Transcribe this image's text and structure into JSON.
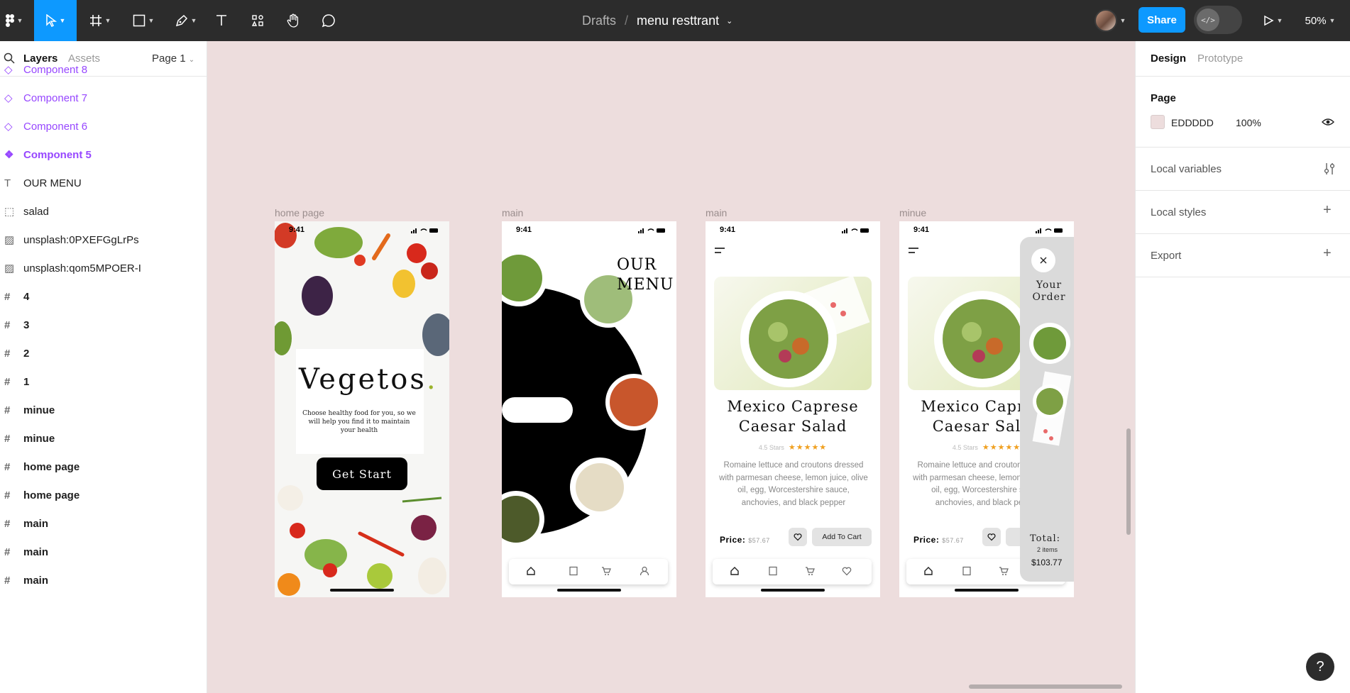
{
  "toolbar": {
    "breadcrumb_drafts": "Drafts",
    "breadcrumb_separator": "/",
    "file_name": "menu resttrant",
    "share_label": "Share",
    "zoom_level": "50%",
    "dev_mode_glyph": "</>",
    "accent_color": "#0d99ff"
  },
  "left_panel": {
    "tab_layers": "Layers",
    "tab_assets": "Assets",
    "page_selector": "Page 1",
    "layers": [
      {
        "label": "Component 8",
        "icon": "component-instance-icon"
      },
      {
        "label": "Component 7",
        "icon": "component-instance-icon"
      },
      {
        "label": "Component 6",
        "icon": "component-instance-icon"
      },
      {
        "label": "Component 5",
        "icon": "main-component-icon"
      },
      {
        "label": "OUR MENU",
        "icon": "text-icon"
      },
      {
        "label": "salad",
        "icon": "group-icon"
      },
      {
        "label": "unsplash:0PXEFGgLrPs",
        "icon": "image-icon"
      },
      {
        "label": "unsplash:qom5MPOER-I",
        "icon": "image-icon"
      },
      {
        "label": "4",
        "icon": "frame-icon"
      },
      {
        "label": "3",
        "icon": "frame-icon"
      },
      {
        "label": "2",
        "icon": "frame-icon"
      },
      {
        "label": "1",
        "icon": "frame-icon"
      },
      {
        "label": "minue",
        "icon": "frame-icon"
      },
      {
        "label": "minue",
        "icon": "frame-icon"
      },
      {
        "label": "home page",
        "icon": "frame-icon"
      },
      {
        "label": "home page",
        "icon": "frame-icon"
      },
      {
        "label": "main",
        "icon": "frame-icon"
      },
      {
        "label": "main",
        "icon": "frame-icon"
      },
      {
        "label": "main",
        "icon": "frame-icon"
      }
    ]
  },
  "canvas": {
    "background_color": "#eddddd",
    "frames": [
      {
        "label": "home page"
      },
      {
        "label": "main"
      },
      {
        "label": "main"
      },
      {
        "label": "minue"
      }
    ],
    "status_time": "9:41",
    "home": {
      "title": "Vegetos",
      "title_dot": ".",
      "subtitle": "Choose healthy food for you, so we will help you find it to maintain your health",
      "button": "Get Start"
    },
    "menu": {
      "heading_line1": "OUR",
      "heading_line2": "MENU"
    },
    "detail": {
      "title_line1": "Mexico Caprese",
      "title_line2": "Caesar Salad",
      "rating_text": "4.5 Stars",
      "stars": "★★★★★",
      "description": "Romaine lettuce and croutons dressed with parmesan cheese, lemon juice, olive oil, egg, Worcestershire sauce, anchovies, and black pepper",
      "price_label": "Price:",
      "price_value": "$57.67",
      "add_to_cart": "Add To Cart",
      "add_to_cart_truncated": "A"
    },
    "order": {
      "title_line1": "Your",
      "title_line2": "Order",
      "total_label": "Total:",
      "total_items": "2 items",
      "total_amount": "$103.77"
    }
  },
  "right_panel": {
    "tab_design": "Design",
    "tab_prototype": "Prototype",
    "page_section": "Page",
    "page_color_hex": "EDDDDD",
    "page_color_opacity": "100%",
    "local_variables": "Local variables",
    "local_styles": "Local styles",
    "export": "Export"
  }
}
